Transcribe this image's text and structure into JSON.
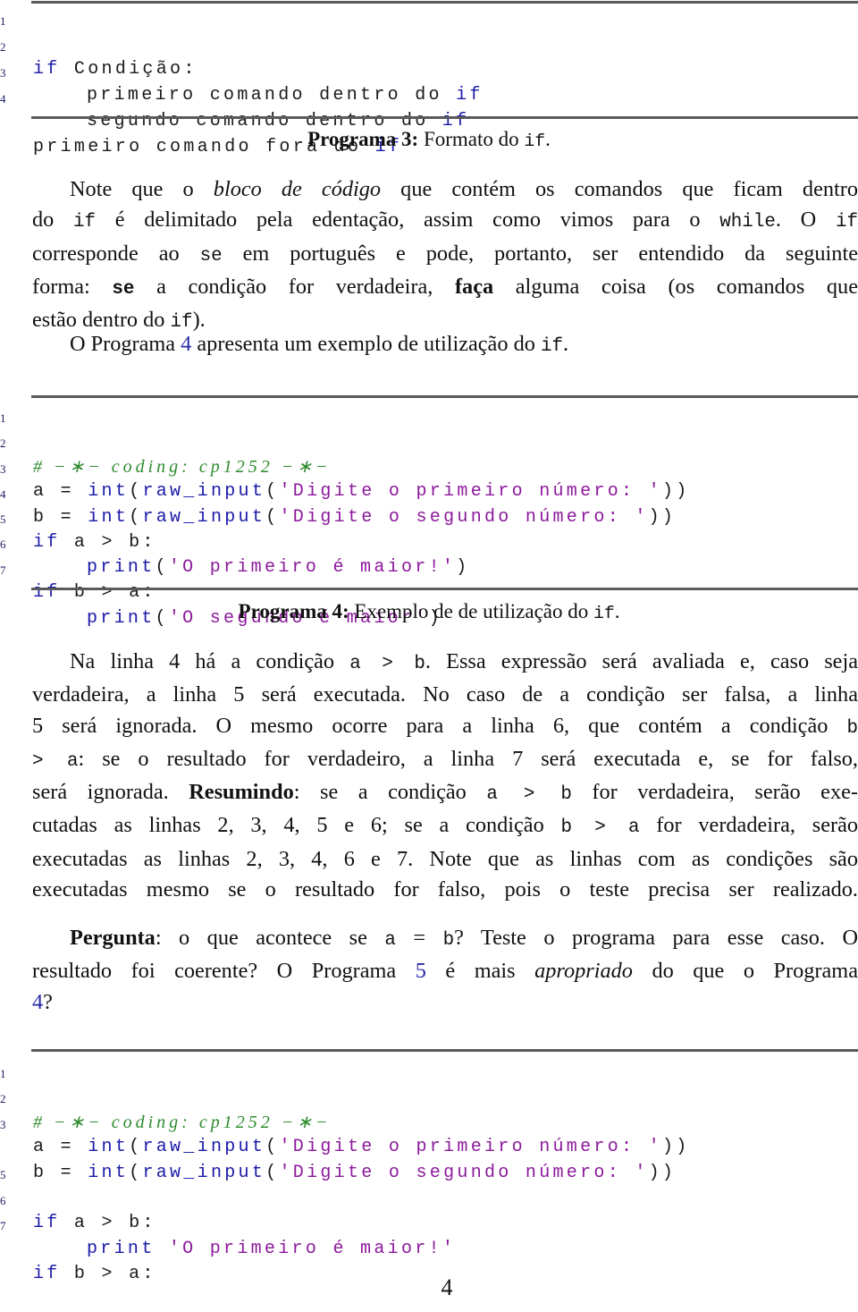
{
  "program3": {
    "lines": [
      {
        "num": "1",
        "kw": "if",
        "rest": " Condição:",
        "indent": ""
      },
      {
        "num": "2",
        "kw": "",
        "rest": "primeiro comando dentro do ",
        "kw_end": "if",
        "indent": "    "
      },
      {
        "num": "3",
        "kw": "",
        "rest": "segundo comando dentro do ",
        "kw_end": "if",
        "indent": "    "
      },
      {
        "num": "4",
        "kw": "",
        "rest": "primeiro comando fora do ",
        "kw_end": "if",
        "indent": ""
      }
    ],
    "caption_label": "Programa 3:",
    "caption_text": "Formato do ",
    "caption_code": "if",
    "caption_end": "."
  },
  "paragraph1": {
    "l1_a": "Note que o ",
    "l1_em": "bloco de código",
    "l1_b": " que contém os comandos que ficam dentro",
    "l2_a": "do ",
    "l2_code1": "if",
    "l2_b": " é delimitado pela edentação, assim como vimos para o ",
    "l2_code2": "while",
    "l2_c": ". O ",
    "l2_code3": "if",
    "l3_a": "corresponde ao ",
    "l3_code": "se",
    "l3_b": " em português e pode, portanto, ser entendido da seguinte",
    "l4_a": "forma: ",
    "l4_code": "se",
    "l4_b": " a condição for verdadeira, ",
    "l4_bold": "faça",
    "l4_c": " alguma coisa (os comandos que",
    "l5_a": "estão dentro do ",
    "l5_code": "if",
    "l5_b": ")."
  },
  "paragraph2": {
    "a": "O Programa ",
    "link": "4",
    "b": " apresenta um exemplo de utilização do ",
    "code": "if",
    "c": "."
  },
  "program4": {
    "comment": "# −∗− coding: cp1252 −∗−",
    "line2_var": "a = ",
    "line3_var": "b = ",
    "func_int": "int",
    "func_raw": "raw_input",
    "str2": "'Digite o primeiro número: '",
    "str3": "'Digite o segundo número: '",
    "close": "))",
    "line4_rest": " a > b:",
    "line5_kw": "print",
    "line5_str": "'O primeiro é maior!'",
    "line6_rest": " b > a:",
    "line7_kw": "print",
    "line7_str": "'O segundo é maior'",
    "kw_if": "if",
    "nums": [
      "1",
      "2",
      "3",
      "4",
      "5",
      "6",
      "7"
    ],
    "caption_label": "Programa 4:",
    "caption_text": "Exemplo de de utilização do ",
    "caption_code": "if",
    "caption_end": "."
  },
  "paragraph3": {
    "l1_a": "Na linha 4 há a condição ",
    "l1_code": "a > b",
    "l1_b": ". Essa expressão será avaliada e, caso seja",
    "l2": "verdadeira, a linha 5 será executada. No caso de a condição ser falsa, a linha",
    "l3_a": "5 será ignorada. O mesmo ocorre para a linha 6, que contém a condição ",
    "l3_code": "b",
    "l4_code": "> a",
    "l4_b": ": se o resultado for verdadeiro, a linha 7 será executada e, se for falso,",
    "l5_a": "será ignorada. ",
    "l5_bold": "Resumindo",
    "l5_b": ": se a condição ",
    "l5_code": "a > b",
    "l5_c": " for verdadeira, serão exe-",
    "l6_a": "cutadas as linhas 2, 3, 4, 5 e 6; se a condição ",
    "l6_code": "b > a",
    "l6_b": " for verdadeira, serão",
    "l7": "executadas as linhas 2, 3, 4, 6 e 7. Note que as linhas com as condições são",
    "l8": "executadas mesmo se o resultado for falso, pois o teste precisa ser realizado."
  },
  "paragraph4": {
    "l1_bold": "Pergunta",
    "l1_a": ": o que acontece se ",
    "l1_code1": "a",
    "l1_b": " = ",
    "l1_code2": "b",
    "l1_c": "? Teste o programa para esse caso. O",
    "l2_a": "resultado foi coerente? O Programa ",
    "l2_link": "5",
    "l2_b": " é mais ",
    "l2_em": "apropriado",
    "l2_c": " do que o Programa",
    "l3_link": "4",
    "l3_a": "?"
  },
  "program5": {
    "comment": "# −∗− coding: cp1252 −∗−",
    "line2_var": "a = ",
    "line3_var": "b = ",
    "func_int": "int",
    "func_raw": "raw_input",
    "str2": "'Digite o primeiro número: '",
    "str3": "'Digite o segundo número: '",
    "close": "))",
    "kw_if": "if",
    "line5_rest": " a > b:",
    "line6_kw": "print",
    "line6_str": " 'O primeiro é maior!'",
    "line7_rest": " b > a:",
    "nums": [
      "1",
      "2",
      "3",
      "5",
      "6",
      "7"
    ]
  },
  "page_number": "4"
}
